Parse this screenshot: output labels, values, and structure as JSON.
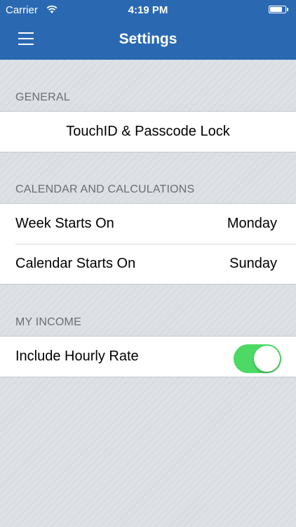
{
  "status_bar": {
    "carrier": "Carrier",
    "time": "4:19 PM"
  },
  "nav": {
    "title": "Settings",
    "menu_icon": "hamburger-menu-icon"
  },
  "sections": {
    "general": {
      "header": "GENERAL",
      "items": [
        {
          "label": "TouchID & Passcode Lock"
        }
      ]
    },
    "calendar": {
      "header": "CALENDAR AND CALCULATIONS",
      "items": [
        {
          "label": "Week Starts On",
          "value": "Monday"
        },
        {
          "label": "Calendar Starts On",
          "value": "Sunday"
        }
      ]
    },
    "income": {
      "header": "MY INCOME",
      "items": [
        {
          "label": "Include Hourly Rate",
          "toggle_on": true
        }
      ]
    }
  },
  "colors": {
    "nav_bar": "#2a69b2",
    "toggle_on": "#4cd964",
    "background": "#dde1e6"
  }
}
